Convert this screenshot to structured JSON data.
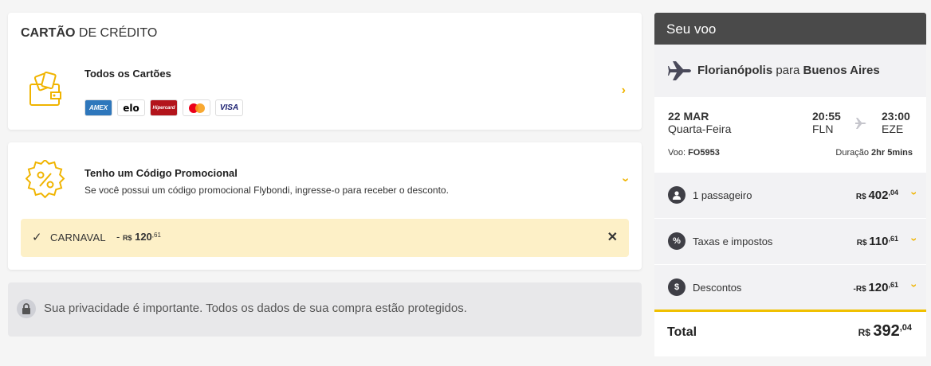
{
  "payment": {
    "title_bold": "CARTÃO",
    "title_rest": " DE CRÉDITO",
    "cards_option": {
      "label": "Todos os Cartões",
      "brands": [
        "AMEX",
        "elo",
        "Hipercard",
        "mastercard",
        "VISA"
      ]
    }
  },
  "promo": {
    "title": "Tenho um Código Promocional",
    "description": "Se você possui um código promocional Flybondi, ingresse-o para receber o desconto.",
    "applied_code": "CARNAVAL",
    "applied_sign": "- ",
    "applied_currency": "R$",
    "applied_int": "120",
    "applied_dec": ",61"
  },
  "privacy": {
    "text": "Sua privacidade é importante. Todos os dados de sua compra estão protegidos."
  },
  "sidebar": {
    "header": "Seu voo",
    "origin": "Florianópolis",
    "connector": " para ",
    "destination": "Buenos Aires",
    "date": "22 MAR",
    "weekday": "Quarta-Feira",
    "depart_time": "20:55",
    "depart_code": "FLN",
    "arrive_time": "23:00",
    "arrive_code": "EZE",
    "flight_label": "Voo: ",
    "flight_number": "FO5953",
    "duration_label": "Duração ",
    "duration_value": "2hr 5mins",
    "rows": [
      {
        "label": "1 passageiro",
        "sign": "",
        "currency": "R$ ",
        "int": "402",
        "dec": ",04"
      },
      {
        "label": "Taxas e impostos",
        "sign": "",
        "currency": "R$ ",
        "int": "110",
        "dec": ",61"
      },
      {
        "label": "Descontos",
        "sign": "-",
        "currency": "R$ ",
        "int": "120",
        "dec": ",61"
      }
    ],
    "total_label": "Total",
    "total_currency": "R$ ",
    "total_int": "392",
    "total_dec": ",04"
  },
  "colors": {
    "accent": "#f0b400",
    "header_bg": "#4a4a4a",
    "promo_applied_bg": "#fdf0c7"
  }
}
